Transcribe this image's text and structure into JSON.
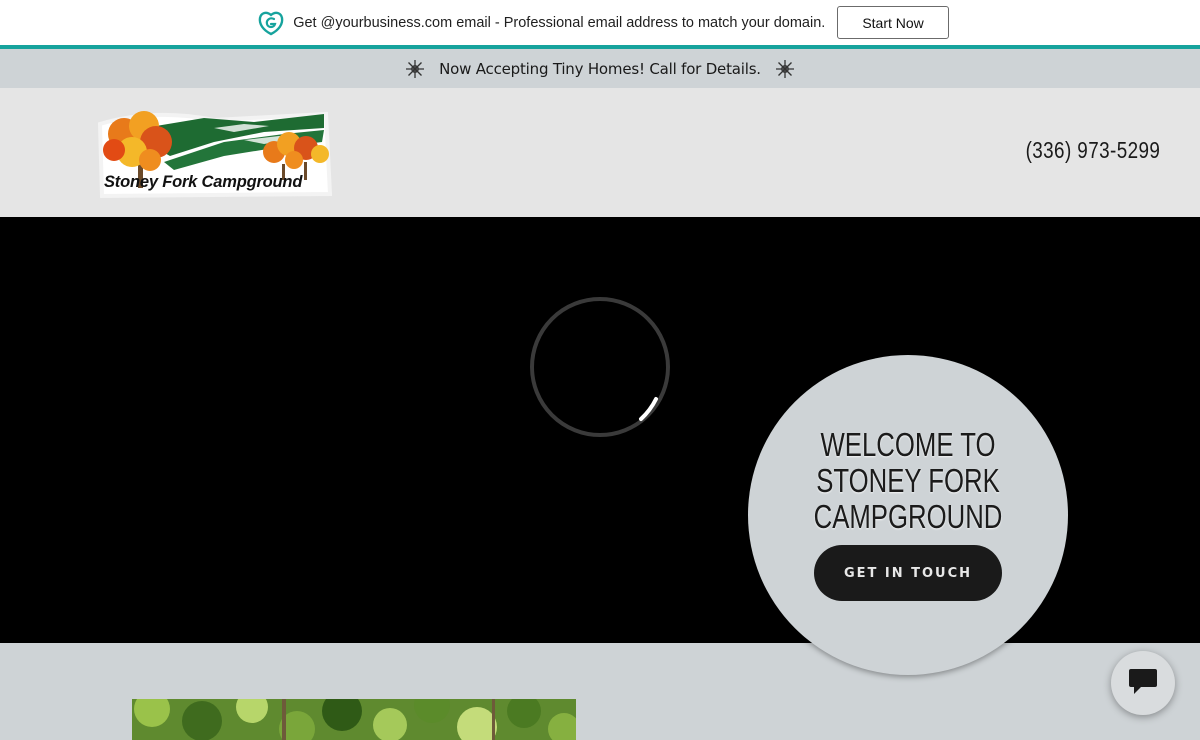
{
  "promo": {
    "icon": "godaddy-heart-icon",
    "text": "Get @yourbusiness.com email - Professional email address to match your domain.",
    "button_label": "Start Now",
    "accent_color": "#16a39d"
  },
  "announcement": {
    "text": "Now Accepting Tiny Homes! Call for Details.",
    "left_icon": "sparkle-icon",
    "right_icon": "sparkle-icon"
  },
  "header": {
    "logo_text": "Stoney Fork Campground",
    "phone": "(336) 973-5299"
  },
  "hero": {
    "title": "WELCOME TO\nSTONEY FORK\nCAMPGROUND",
    "cta_label": "GET IN TOUCH",
    "loading_icon": "loading-spinner-icon"
  },
  "chat": {
    "icon": "chat-bubble-icon"
  }
}
